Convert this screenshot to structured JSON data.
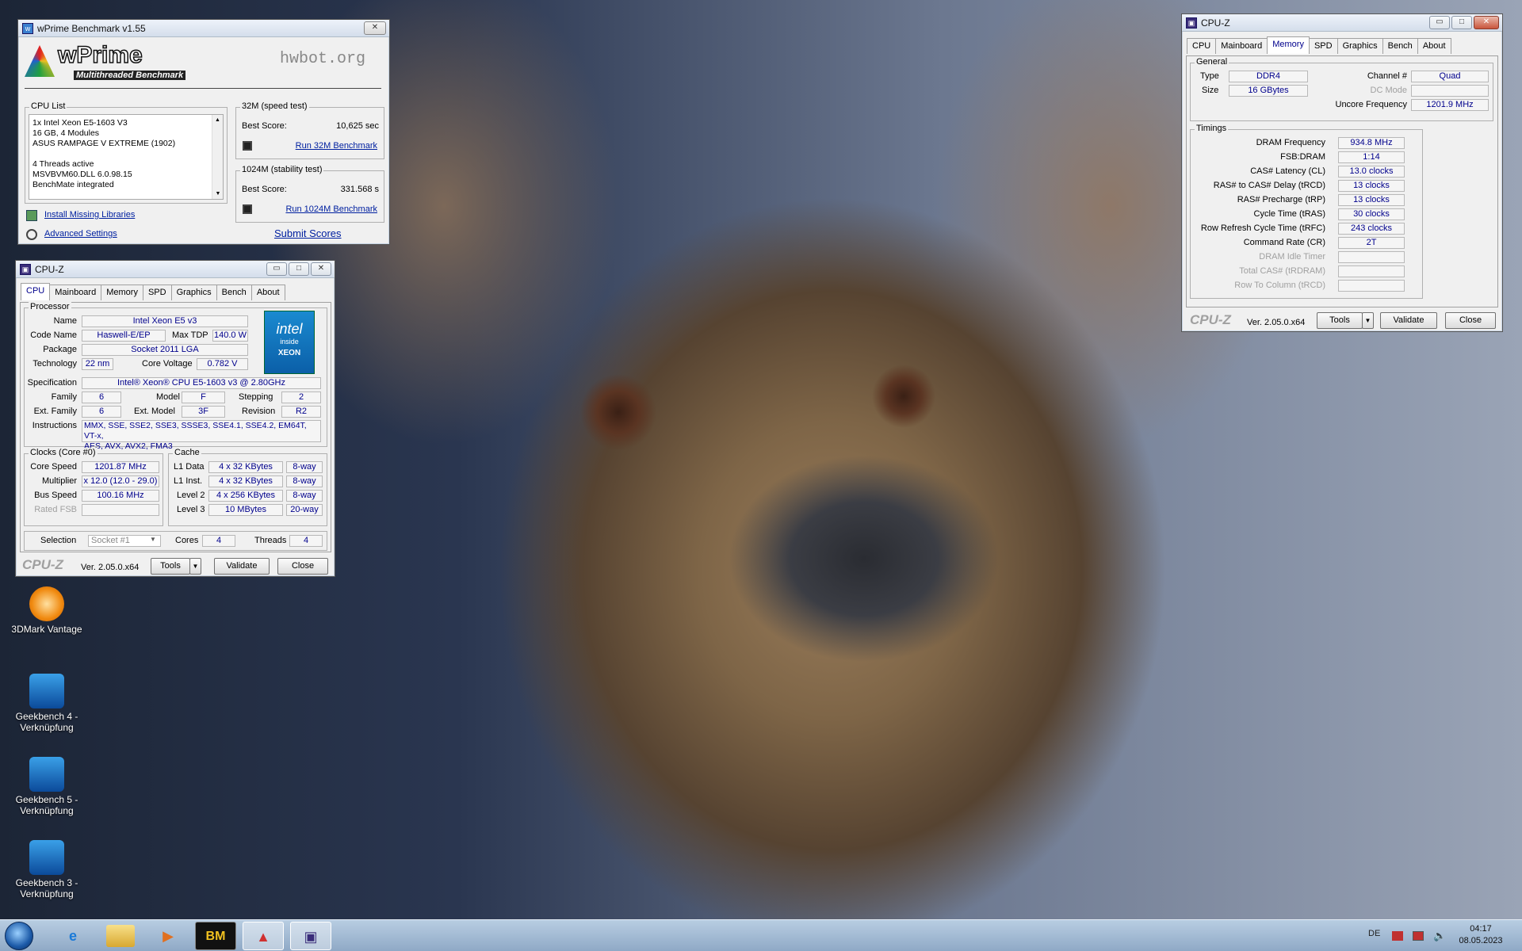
{
  "desktop": {
    "icons": [
      {
        "label": "3DMark Vantage"
      },
      {
        "label": "Geekbench 4 - Verknüpfung"
      },
      {
        "label": "Geekbench 5 - Verknüpfung"
      },
      {
        "label": "Geekbench 3 - Verknüpfung"
      }
    ]
  },
  "wprime": {
    "title": "wPrime Benchmark v1.55",
    "logo": "wPrime",
    "logo_sub": "Multithreaded Benchmark",
    "hwbot": "hwbot.org",
    "cpu_list_title": "CPU List",
    "cpu_list": [
      "1x Intel Xeon E5-1603 V3",
      "16 GB, 4 Modules",
      "ASUS RAMPAGE V EXTREME (1902)",
      "",
      "4 Threads active",
      "MSVBVM60.DLL 6.0.98.15",
      "BenchMate integrated"
    ],
    "speed_title": "32M (speed test)",
    "best_label": "Best Score:",
    "speed_score": "10,625 sec",
    "run32": "Run 32M Benchmark",
    "stab_title": "1024M (stability test)",
    "stab_score": "331.568 s",
    "run1024": "Run 1024M Benchmark",
    "install": "Install Missing Libraries",
    "advanced": "Advanced Settings",
    "submit": "Submit Scores"
  },
  "cpuz_cpu": {
    "title": "CPU-Z",
    "tabs": [
      "CPU",
      "Mainboard",
      "Memory",
      "SPD",
      "Graphics",
      "Bench",
      "About"
    ],
    "processor": "Processor",
    "name_l": "Name",
    "name": "Intel Xeon E5 v3",
    "codename_l": "Code Name",
    "codename": "Haswell-E/EP",
    "maxtdp_l": "Max TDP",
    "maxtdp": "140.0 W",
    "package_l": "Package",
    "package": "Socket 2011 LGA",
    "tech_l": "Technology",
    "tech": "22 nm",
    "cv_l": "Core Voltage",
    "cv": "0.782 V",
    "spec_l": "Specification",
    "spec": "Intel® Xeon® CPU E5-1603 v3 @ 2.80GHz",
    "family_l": "Family",
    "family": "6",
    "model_l": "Model",
    "model": "F",
    "stepping_l": "Stepping",
    "stepping": "2",
    "extfam_l": "Ext. Family",
    "extfam": "6",
    "extmod_l": "Ext. Model",
    "extmod": "3F",
    "rev_l": "Revision",
    "rev": "R2",
    "instr_l": "Instructions",
    "instr1": "MMX, SSE, SSE2, SSE3, SSSE3, SSE4.1, SSE4.2, EM64T, VT-x,",
    "instr2": "AES, AVX, AVX2, FMA3",
    "clocks": "Clocks (Core #0)",
    "cs_l": "Core Speed",
    "cs": "1201.87 MHz",
    "mult_l": "Multiplier",
    "mult": "x 12.0 (12.0 - 29.0)",
    "bus_l": "Bus Speed",
    "bus": "100.16 MHz",
    "fsb_l": "Rated FSB",
    "cache": "Cache",
    "l1d_l": "L1 Data",
    "l1d": "4 x 32 KBytes",
    "l1d_w": "8-way",
    "l1i_l": "L1 Inst.",
    "l1i": "4 x 32 KBytes",
    "l1i_w": "8-way",
    "l2_l": "Level 2",
    "l2": "4 x 256 KBytes",
    "l2_w": "8-way",
    "l3_l": "Level 3",
    "l3": "10 MBytes",
    "l3_w": "20-way",
    "sel_l": "Selection",
    "sel": "Socket #1",
    "cores_l": "Cores",
    "cores": "4",
    "threads_l": "Threads",
    "threads": "4",
    "logo": "CPU-Z",
    "ver": "Ver. 2.05.0.x64",
    "tools": "Tools",
    "validate": "Validate",
    "close": "Close",
    "intel": "intel",
    "inside": "inside",
    "xeon": "XEON"
  },
  "cpuz_mem": {
    "title": "CPU-Z",
    "tabs": [
      "CPU",
      "Mainboard",
      "Memory",
      "SPD",
      "Graphics",
      "Bench",
      "About"
    ],
    "general": "General",
    "type_l": "Type",
    "type": "DDR4",
    "size_l": "Size",
    "size": "16 GBytes",
    "chan_l": "Channel #",
    "chan": "Quad",
    "dc_l": "DC Mode",
    "unc_l": "Uncore Frequency",
    "unc": "1201.9 MHz",
    "timings": "Timings",
    "rows": [
      {
        "l": "DRAM Frequency",
        "v": "934.8 MHz",
        "d": false
      },
      {
        "l": "FSB:DRAM",
        "v": "1:14",
        "d": false
      },
      {
        "l": "CAS# Latency (CL)",
        "v": "13.0 clocks",
        "d": false
      },
      {
        "l": "RAS# to CAS# Delay (tRCD)",
        "v": "13 clocks",
        "d": false
      },
      {
        "l": "RAS# Precharge (tRP)",
        "v": "13 clocks",
        "d": false
      },
      {
        "l": "Cycle Time (tRAS)",
        "v": "30 clocks",
        "d": false
      },
      {
        "l": "Row Refresh Cycle Time (tRFC)",
        "v": "243 clocks",
        "d": false
      },
      {
        "l": "Command Rate (CR)",
        "v": "2T",
        "d": false
      },
      {
        "l": "DRAM Idle Timer",
        "v": "",
        "d": true
      },
      {
        "l": "Total CAS# (tRDRAM)",
        "v": "",
        "d": true
      },
      {
        "l": "Row To Column (tRCD)",
        "v": "",
        "d": true
      }
    ],
    "logo": "CPU-Z",
    "ver": "Ver. 2.05.0.x64",
    "tools": "Tools",
    "validate": "Validate",
    "close": "Close"
  },
  "taskbar": {
    "lang": "DE",
    "time": "04:17",
    "date": "08.05.2023",
    "bm": "BM"
  }
}
